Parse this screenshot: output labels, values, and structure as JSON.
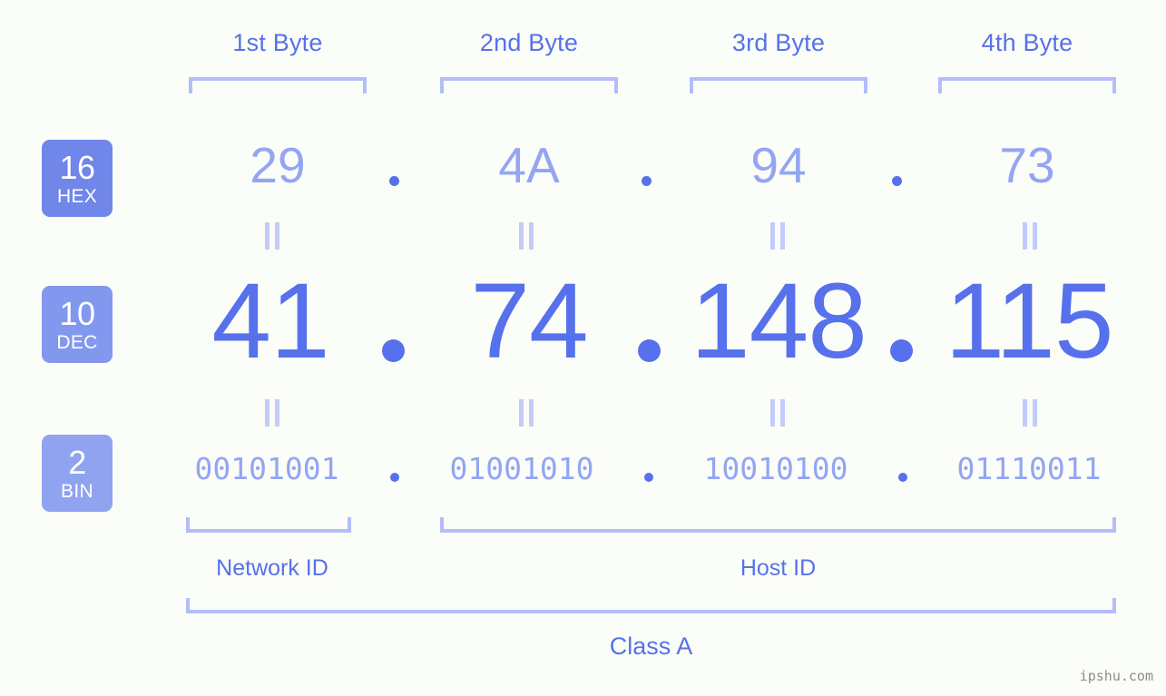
{
  "meta": {
    "background": "#fbfdf8",
    "accent_strong": "#5671eb",
    "accent_light": "#93a5f3",
    "bracket_color": "#b3bdfb",
    "eq_color": "#c3cbfb"
  },
  "byte_headers": [
    {
      "label": "1st Byte"
    },
    {
      "label": "2nd Byte"
    },
    {
      "label": "3rd Byte"
    },
    {
      "label": "4th Byte"
    }
  ],
  "bases": [
    {
      "num": "16",
      "abbr": "HEX",
      "color": "#7086e8"
    },
    {
      "num": "10",
      "abbr": "DEC",
      "color": "#8298ee"
    },
    {
      "num": "2",
      "abbr": "BIN",
      "color": "#8fa3f0"
    }
  ],
  "rows": {
    "hex": {
      "base": "16",
      "abbr": "HEX",
      "values": [
        "29",
        "4A",
        "94",
        "73"
      ],
      "separator": "."
    },
    "dec": {
      "base": "10",
      "abbr": "DEC",
      "values": [
        "41",
        "74",
        "148",
        "115"
      ],
      "separator": "."
    },
    "bin": {
      "base": "2",
      "abbr": "BIN",
      "values": [
        "00101001",
        "01001010",
        "10010100",
        "01110011"
      ],
      "separator": "."
    }
  },
  "equality_symbol": "=",
  "sections": [
    {
      "label": "Network ID"
    },
    {
      "label": "Host ID"
    }
  ],
  "class": {
    "label": "Class A"
  },
  "watermark": {
    "text": "ipshu.com"
  }
}
